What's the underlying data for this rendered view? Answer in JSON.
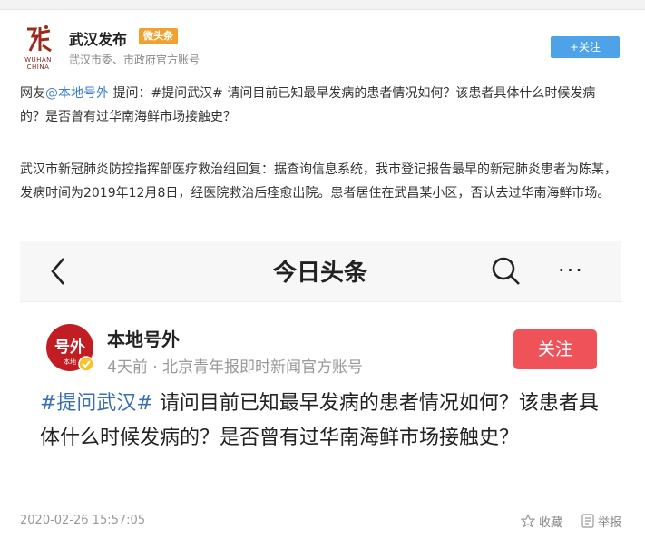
{
  "account": {
    "name": "武汉发布",
    "badge": "微头条",
    "subtitle": "武汉市委、市政府官方账号",
    "logo_text": "WUHAN\nCHINA",
    "follow_label": "+关注"
  },
  "post": {
    "intro_prefix": "网友",
    "mention": "@本地号外",
    "question": " 提问：#提问武汉# 请问目前已知最早发病的患者情况如何？该患者具体什么时候发病的？是否曾有过华南海鲜市场接触史？",
    "reply": "武汉市新冠肺炎防控指挥部医疗救治组回复：据查询信息系统，我市登记报告最早的新冠肺炎患者为陈某，发病时间为2019年12月8日，经医院救治后痊愈出院。患者居住在武昌某小区，否认去过华南海鲜市场。"
  },
  "embed": {
    "app_title": "今日头条",
    "more_label": "···",
    "author": "本地号外",
    "avatar_text": "号外",
    "avatar_sub": "本地",
    "meta": "4天前 · 北京青年报即时新闻官方账号",
    "follow_label": "关注",
    "tag": "#提问武汉#",
    "text": " 请问目前已知最早发病的患者情况如何？该患者具体什么时候发病的？是否曾有过华南海鲜市场接触史？"
  },
  "footer": {
    "timestamp": "2020-02-26 15:57:05",
    "favorite_label": "收藏",
    "report_label": "举报"
  },
  "colors": {
    "link": "#3f7fc8",
    "badge": "#f0a231",
    "follow_blue": "#4ea3e8",
    "follow_red": "#f0525a",
    "logo_red": "#9c2a1c"
  },
  "icons": [
    "wuhan-logo-icon",
    "back-arrow-icon",
    "search-icon",
    "more-icon",
    "verified-icon",
    "star-icon",
    "report-icon"
  ]
}
